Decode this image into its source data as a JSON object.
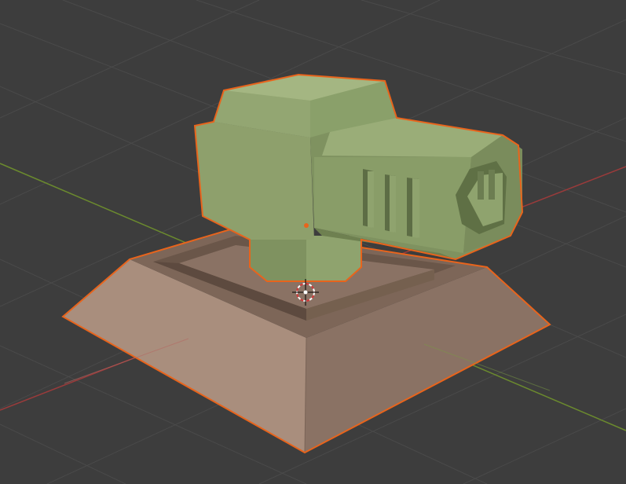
{
  "viewport": {
    "background": "#3d3d3d",
    "grid_color": "#4a4a4a",
    "x_axis_color": "#9a3b3b",
    "y_axis_color": "#6b8a2e",
    "selection_outline_color": "#e8641c",
    "origin_marker_color": "#e8641c"
  },
  "model": {
    "turret_color": "#8fa36e",
    "base_color": "#a88a78",
    "icon": "turret-object"
  },
  "cursor": {
    "icon": "3d-cursor-icon",
    "ring_colors": [
      "#ffffff",
      "#d23a3a"
    ]
  }
}
